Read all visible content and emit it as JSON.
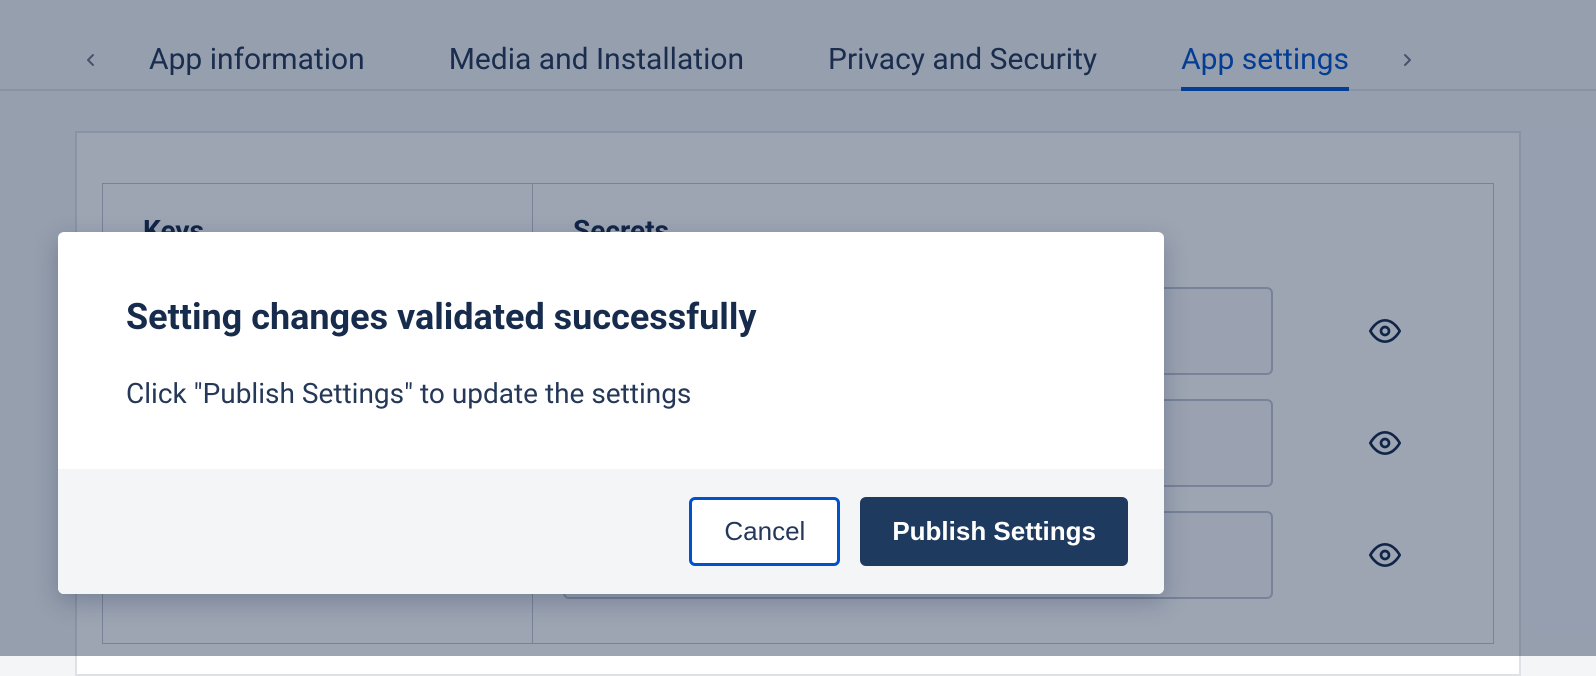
{
  "tabs": {
    "items": [
      {
        "label": "App information"
      },
      {
        "label": "Media and Installation"
      },
      {
        "label": "Privacy and Security"
      },
      {
        "label": "App settings"
      }
    ],
    "activeIndex": 3
  },
  "table": {
    "keysHeader": "Keys",
    "secretsHeader": "Secrets"
  },
  "modal": {
    "title": "Setting changes validated successfully",
    "body": "Click \"Publish Settings\" to update the settings",
    "cancelLabel": "Cancel",
    "publishLabel": "Publish Settings"
  }
}
